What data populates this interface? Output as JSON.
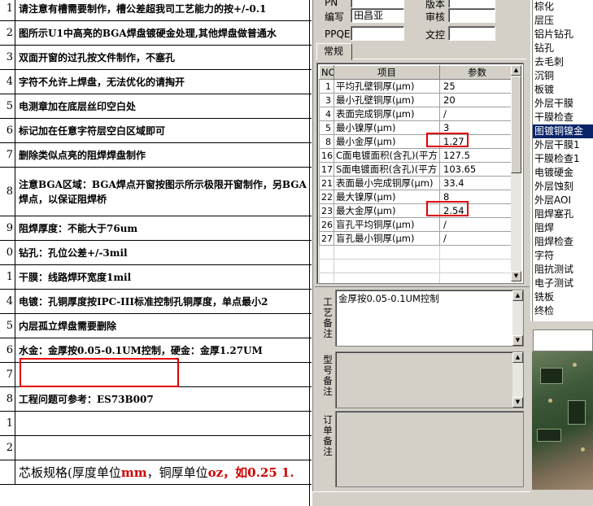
{
  "doc": {
    "rows": [
      {
        "num": "1",
        "text": "请注意有槽需要制作，槽公差超我司工艺能力的按+/-0.1"
      },
      {
        "num": "2",
        "text": "图所示U1中高亮的BGA焊盘镀硬金处理,其他焊盘做普通水"
      },
      {
        "num": "3",
        "text": "双面开窗的过孔按文件制作，不塞孔"
      },
      {
        "num": "4",
        "text": "字符不允许上焊盘，无法优化的请掏开"
      },
      {
        "num": "5",
        "text": "电测章加在底层丝印空白处"
      },
      {
        "num": "6",
        "text": "标记加在任意字符层空白区域即可"
      },
      {
        "num": "7",
        "text": "删除类似点亮的阻焊焊盘制作"
      },
      {
        "num": "8",
        "text": "注意BGA区域：BGA焊点开窗按图示所示极限开窗制作，另BGA焊点，以保证阻焊桥"
      },
      {
        "num": "9",
        "text": "阻焊厚度：不能大于76um"
      },
      {
        "num": "0",
        "text": "钻孔：孔位公差+/-3mil"
      },
      {
        "num": "1",
        "text": "干膜：线路焊环宽度1mil"
      },
      {
        "num": "4",
        "text": "电镀：孔铜厚度按IPC-III标准控制孔铜厚度，单点最小2"
      },
      {
        "num": "5",
        "text": "内层孤立焊盘需要删除"
      },
      {
        "num": "6",
        "text": "水金：金厚按0.05-0.1UM控制，硬金：金厚1.27UM"
      },
      {
        "num": "7",
        "text": ""
      },
      {
        "num": "8",
        "text": "工程问题可参考：ES73B007"
      },
      {
        "num": "1",
        "text": ""
      },
      {
        "num": "2",
        "text": ""
      }
    ],
    "footer": {
      "num": "",
      "prefix": "芯板规格(厚度单位",
      "unit1": "mm",
      "mid": "，铜厚单位",
      "unit2": "oz",
      "suffix": "，如0.25 1."
    }
  },
  "app": {
    "top_labels": {
      "pn": "PN",
      "rev": "版本",
      "editor_label": "编写",
      "editor_value": "田昌亚",
      "review_label": "审核",
      "ppqe_label": "PPQE",
      "doc_ctrl_label": "文控"
    },
    "tab_label": "常规",
    "grid": {
      "headers": [
        "NO",
        "项目",
        "参数"
      ],
      "rows": [
        {
          "no": "1",
          "item": "平均孔壁铜厚(μm)",
          "value": "25"
        },
        {
          "no": "3",
          "item": "最小孔壁铜厚(μm)",
          "value": "20"
        },
        {
          "no": "4",
          "item": "表面完成铜厚(μm)",
          "value": "/"
        },
        {
          "no": "5",
          "item": "最小镍厚(μm)",
          "value": "3"
        },
        {
          "no": "8",
          "item": "最小金厚(μm)",
          "value": "1.27"
        },
        {
          "no": "16",
          "item": "C面电镀面积(含孔)(平方",
          "value": "127.5"
        },
        {
          "no": "17",
          "item": "S面电镀面积(含孔)(平方",
          "value": "103.65"
        },
        {
          "no": "21",
          "item": "表面最小完成铜厚(μm)",
          "value": "33.4"
        },
        {
          "no": "22",
          "item": "最大镍厚(μm)",
          "value": "8"
        },
        {
          "no": "23",
          "item": "最大金厚(μm)",
          "value": "2.54"
        },
        {
          "no": "26",
          "item": "盲孔平均铜厚(μm)",
          "value": "/"
        },
        {
          "no": "27",
          "item": "盲孔最小铜厚(μm)",
          "value": "/"
        }
      ]
    },
    "notes": {
      "process_label": "工艺备注",
      "process_text": "金厚按0.05-0.1UM控制",
      "model_label": "型号备注",
      "order_label": "订单备注"
    }
  },
  "process_list": {
    "items": [
      "棕化",
      "层压",
      "铝片钻孔",
      "钻孔",
      "去毛刺",
      "沉铜",
      "板镀",
      "外层干膜",
      "干膜检查",
      "图镀铜镍金",
      "外层干膜1",
      "干膜检查1",
      "电镀硬金",
      "外层蚀刻",
      "外层AOI",
      "阻焊塞孔",
      "阻焊",
      "阻焊检查",
      "字符",
      "阻抗测试",
      "电子测试",
      "铣板",
      "终检"
    ],
    "selected_index": 9
  },
  "colors": {
    "highlight_red": "#e00000",
    "selection_blue": "#0a246a",
    "panel_gray": "#d4d0c8"
  }
}
